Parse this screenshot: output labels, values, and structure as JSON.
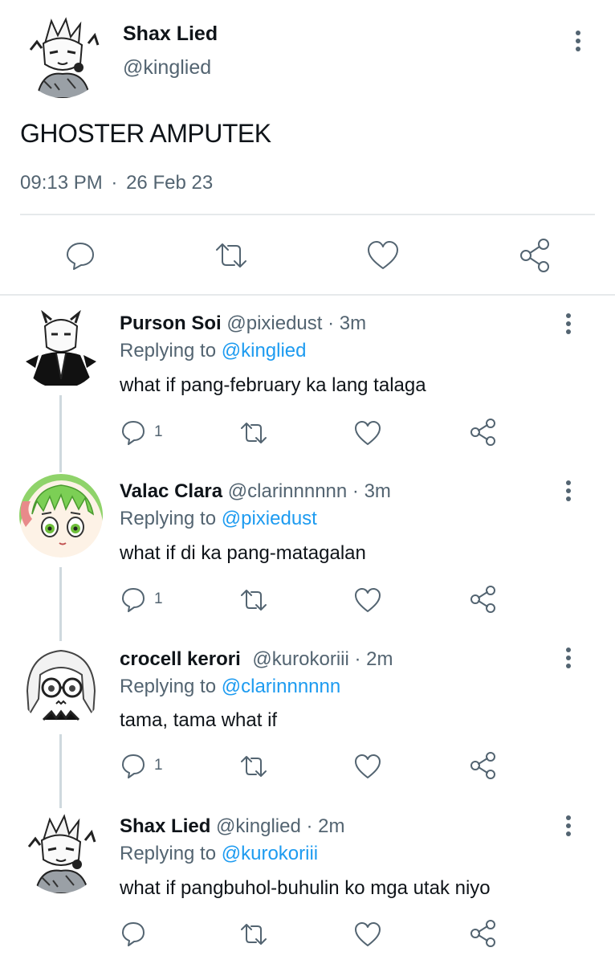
{
  "main_tweet": {
    "name": "Shax Lied",
    "handle": "@kinglied",
    "text": "GHOSTER AMPUTEK",
    "time": "09:13 PM",
    "date": "26 Feb 23",
    "separator": "·"
  },
  "reply_prefix": "Replying to",
  "replies": [
    {
      "name": "Purson Soi",
      "handle": "@pixiedust",
      "dot": "·",
      "time": "3m",
      "replying_to": "@kinglied",
      "text": "what if pang-february ka lang talaga",
      "reply_count": "1"
    },
    {
      "name": "Valac Clara",
      "handle": "@clarinnnnnn",
      "dot": "·",
      "time": "3m",
      "replying_to": "@pixiedust",
      "text": "what if di ka pang-matagalan",
      "reply_count": "1"
    },
    {
      "name": "crocell kerori",
      "handle": "@kurokoriii",
      "dot": "·",
      "time": "2m",
      "replying_to": "@clarinnnnnn",
      "text": "tama, tama what if",
      "reply_count": "1"
    },
    {
      "name": "Shax Lied",
      "handle": "@kinglied",
      "dot": "·",
      "time": "2m",
      "replying_to": "@kurokoriii",
      "text": "what if pangbuhol-buhulin ko mga utak niyo",
      "reply_count": ""
    }
  ],
  "icons": {
    "reply": "reply-icon",
    "retweet": "retweet-icon",
    "like": "like-icon",
    "share": "share-icon",
    "more": "more-options-icon"
  },
  "colors": {
    "text": "#0f1419",
    "muted": "#536471",
    "link": "#1d9bf0",
    "divider": "#e6e9eb",
    "thread_line": "#cfd9de"
  }
}
